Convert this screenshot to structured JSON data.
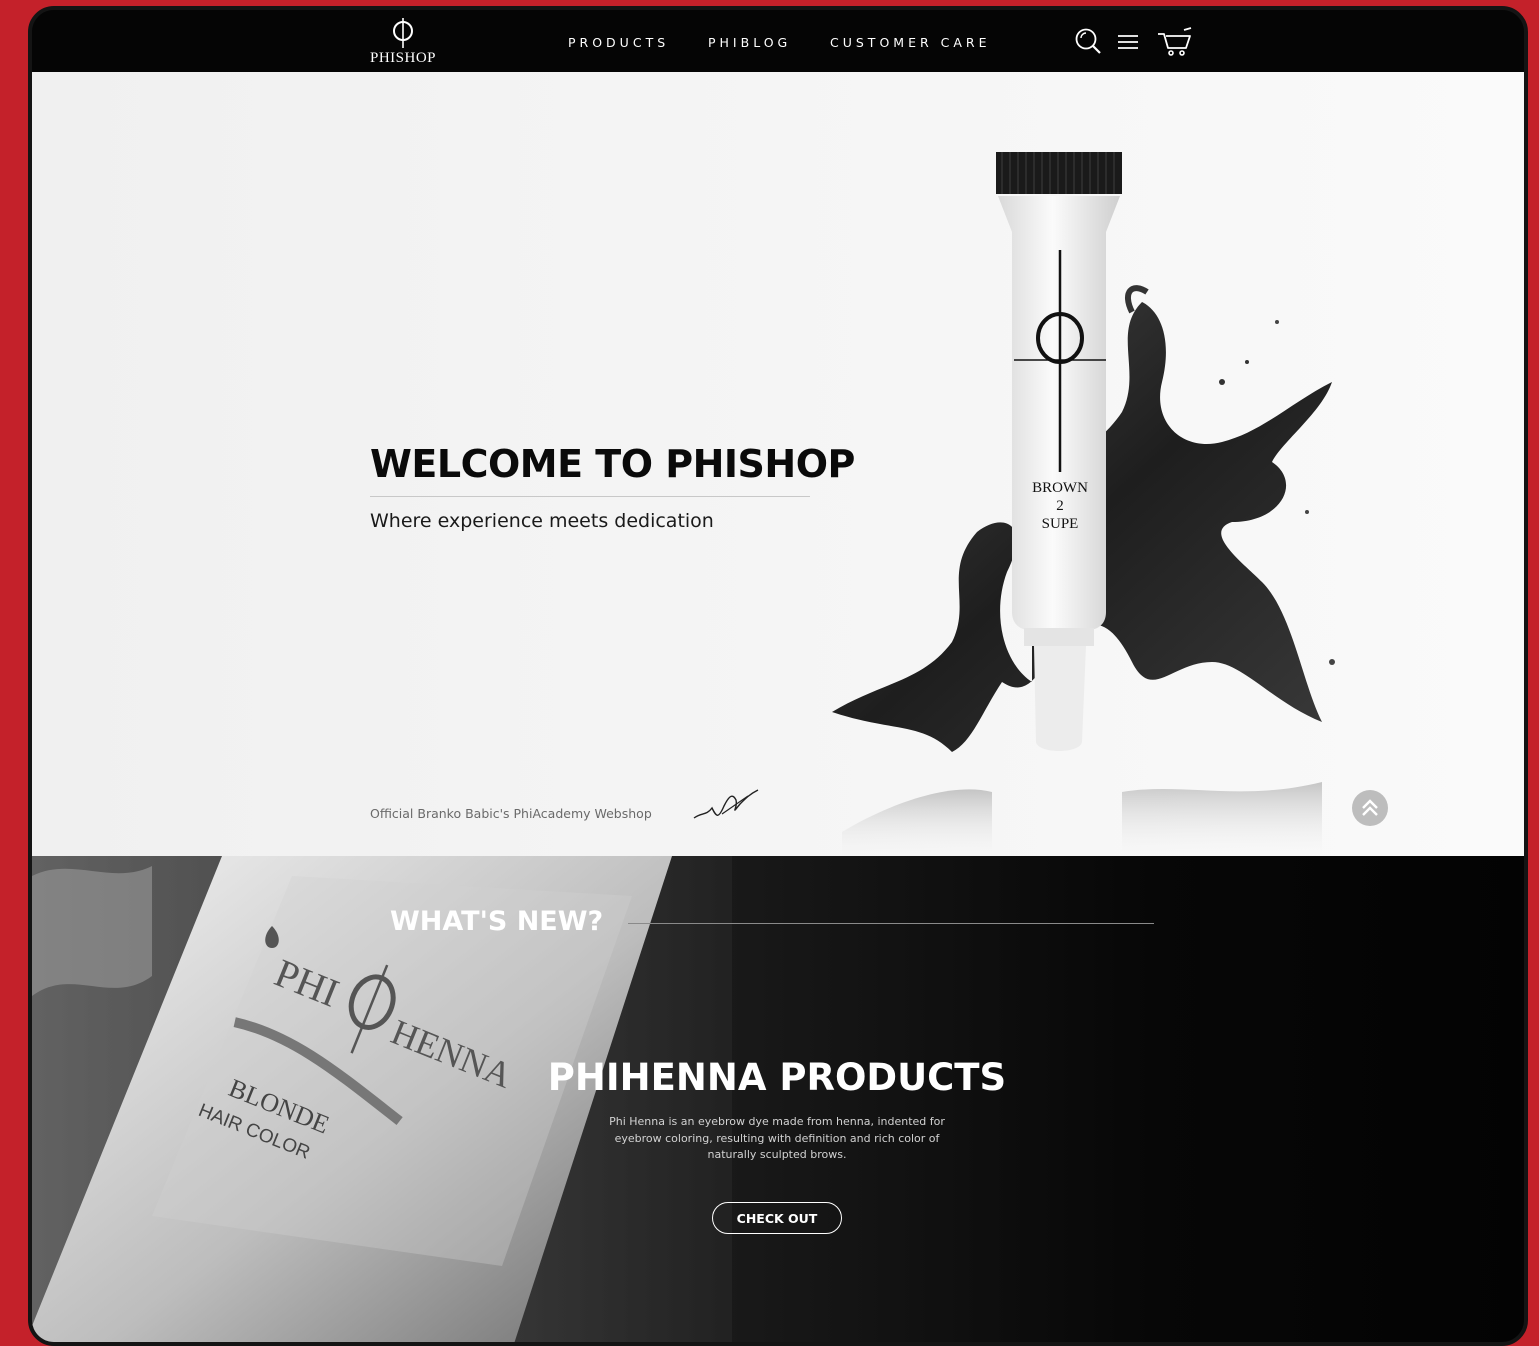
{
  "nav": {
    "logo_text": "PHISHOP",
    "links": [
      "PRODUCTS",
      "PHIBLOG",
      "CUSTOMER CARE"
    ],
    "icons": [
      "search-icon",
      "menu-icon",
      "cart-icon"
    ]
  },
  "hero": {
    "title": "WELCOME TO PHISHOP",
    "subtitle": "Where experience meets dedication",
    "footnote": "Official Branko Babic's PhiAcademy Webshop",
    "product_label": [
      "BROWN",
      "2",
      "SUPE"
    ]
  },
  "news": {
    "heading": "WHAT'S NEW?",
    "feature_title": "PHIHENNA PRODUCTS",
    "feature_description": "Phi Henna is an eyebrow dye made from henna, indented for eyebrow coloring, resulting with definition and rich color of naturally sculpted brows.",
    "cta_label": "CHECK OUT",
    "package_brand": [
      "PHI",
      "HENNA"
    ],
    "package_shade": "BLONDE",
    "package_type": "HAIR COLOR"
  },
  "colors": {
    "outer_background": "#c4212a",
    "nav_background": "#050505",
    "hero_background": "#f4f4f4",
    "news_background": "#070707",
    "text_light": "#ffffff"
  }
}
